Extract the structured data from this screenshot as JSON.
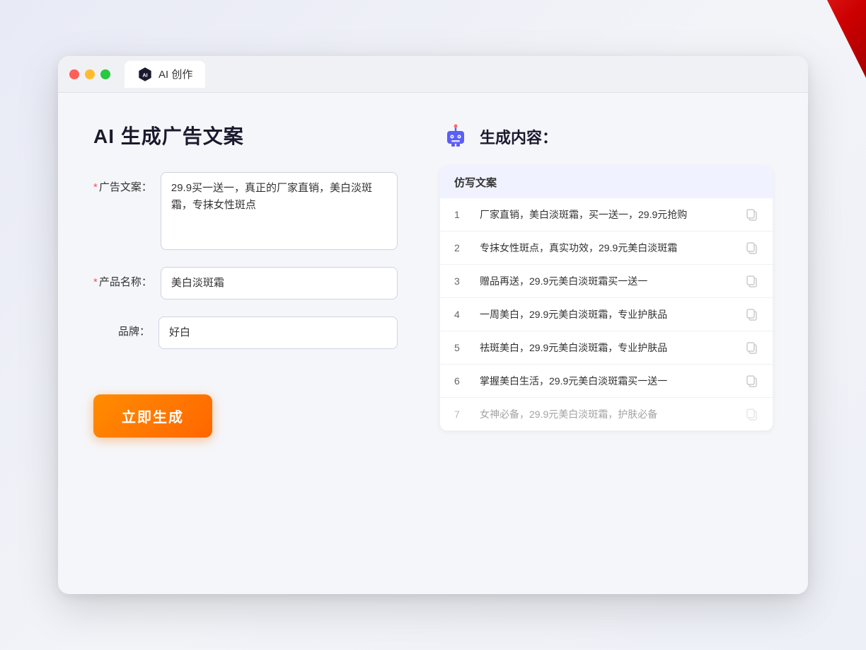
{
  "deco": {
    "label": "decoration"
  },
  "titlebar": {
    "tab_label": "AI 创作"
  },
  "left": {
    "page_title": "AI 生成广告文案",
    "fields": [
      {
        "id": "ad_copy",
        "label": "广告文案：",
        "required": true,
        "required_mark": "*",
        "type": "textarea",
        "value": "29.9买一送一，真正的厂家直销，美白淡斑霜，专抹女性斑点",
        "placeholder": ""
      },
      {
        "id": "product_name",
        "label": "产品名称：",
        "required": true,
        "required_mark": "*",
        "type": "input",
        "value": "美白淡斑霜",
        "placeholder": ""
      },
      {
        "id": "brand",
        "label": "品牌：",
        "required": false,
        "required_mark": "",
        "type": "input",
        "value": "好白",
        "placeholder": ""
      }
    ],
    "generate_btn_label": "立即生成"
  },
  "right": {
    "result_title": "生成内容：",
    "table_header": "仿写文案",
    "results": [
      {
        "num": "1",
        "text": "厂家直销，美白淡斑霜，买一送一，29.9元抢购",
        "faded": false
      },
      {
        "num": "2",
        "text": "专抹女性斑点，真实功效，29.9元美白淡斑霜",
        "faded": false
      },
      {
        "num": "3",
        "text": "赠品再送，29.9元美白淡斑霜买一送一",
        "faded": false
      },
      {
        "num": "4",
        "text": "一周美白，29.9元美白淡斑霜，专业护肤品",
        "faded": false
      },
      {
        "num": "5",
        "text": "祛斑美白，29.9元美白淡斑霜，专业护肤品",
        "faded": false
      },
      {
        "num": "6",
        "text": "掌握美白生活，29.9元美白淡斑霜买一送一",
        "faded": false
      },
      {
        "num": "7",
        "text": "女神必备，29.9元美白淡斑霜，护肤必备",
        "faded": true
      }
    ]
  }
}
